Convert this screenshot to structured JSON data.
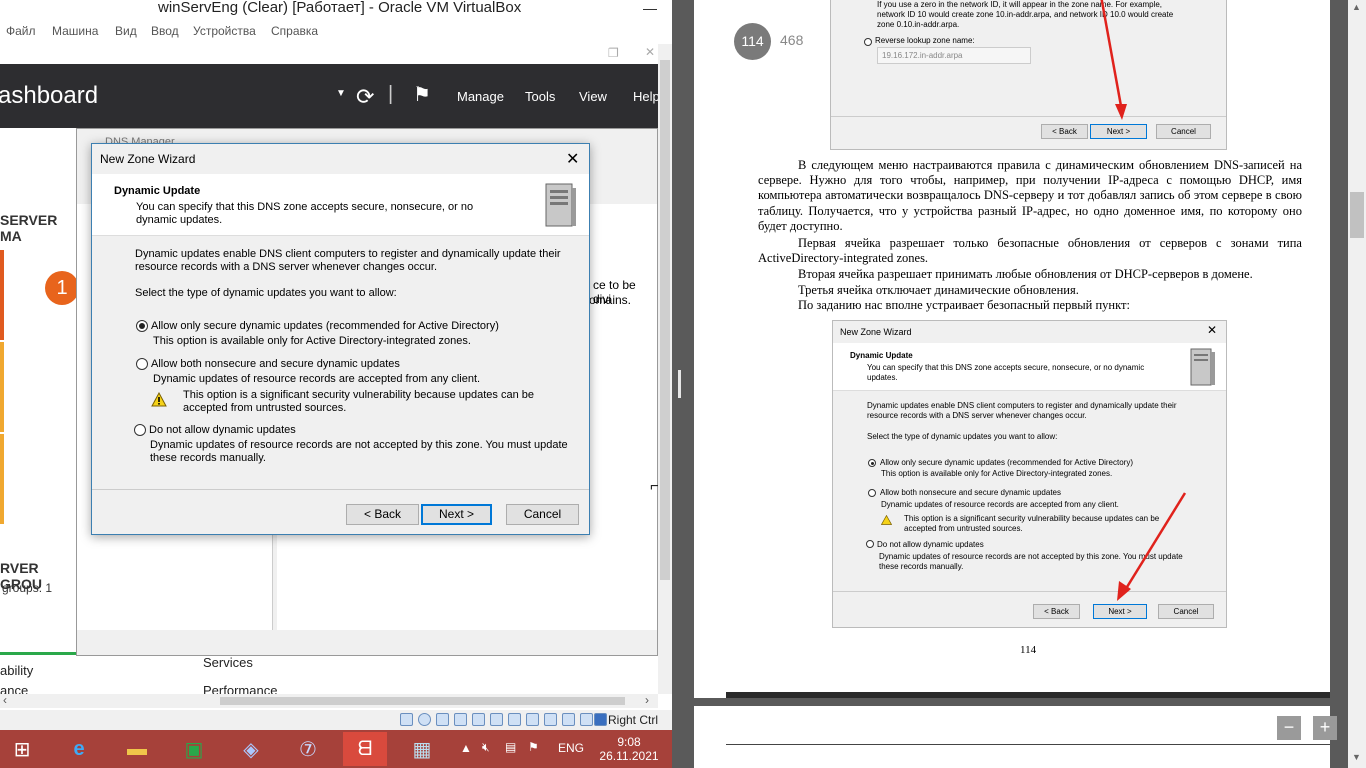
{
  "vbox": {
    "title": "winServEng (Clear) [Работает] - Oracle VM VirtualBox",
    "menu": [
      "Файл",
      "Машина",
      "Вид",
      "Ввод",
      "Устройства",
      "Справка"
    ],
    "status_right_ctrl": "Right Ctrl"
  },
  "server_manager": {
    "title": "ashboard",
    "menu": [
      "Manage",
      "Tools",
      "View",
      "Help"
    ],
    "left_heading": "SERVER MA",
    "groups_heading": "RVER GROU",
    "groups_count": "groups: 1",
    "quick_number": "1",
    "left_item": "ability",
    "lower_items": [
      "Services",
      "Performance"
    ],
    "lower_left": "ance",
    "partial_text": [
      "ce to be divi",
      "omains."
    ]
  },
  "dns_manager": {
    "title": "DNS Manager"
  },
  "wizard": {
    "title": "New Zone Wizard",
    "heading": "Dynamic Update",
    "subheading": "You can specify that this DNS zone accepts secure, nonsecure, or no dynamic updates.",
    "intro": "Dynamic updates enable DNS client computers to register and dynamically update their resource records with a DNS server whenever changes occur.",
    "prompt": "Select the type of dynamic updates you want to allow:",
    "options": [
      {
        "label": "Allow only secure dynamic updates (recommended for Active Directory)",
        "desc": "This option is available only for Active Directory-integrated zones.",
        "selected": true
      },
      {
        "label": "Allow both nonsecure and secure dynamic updates",
        "desc": "Dynamic updates of resource records are accepted from any client.",
        "warning": "This option is a significant security vulnerability because updates can be accepted from untrusted sources.",
        "selected": false
      },
      {
        "label": "Do not allow dynamic updates",
        "desc": "Dynamic updates of resource records are not accepted by this zone. You must update these records manually.",
        "selected": false
      }
    ],
    "back": "< Back",
    "next": "Next >",
    "cancel": "Cancel"
  },
  "taskbar": {
    "lang": "ENG",
    "time": "9:08",
    "date": "26.11.2021"
  },
  "pdf": {
    "current_page": "114",
    "total_pages": "468",
    "page_number": "114",
    "top_shot": {
      "text1": "If you use a zero in the network ID, it will appear in the zone name. For example, network ID 10 would create zone 10.in-addr.arpa, and network ID 10.0 would create zone 0.10.in-addr.arpa.",
      "radio": "Reverse lookup zone name:",
      "field": "19.16.172.in-addr.arpa",
      "back": "< Back",
      "next": "Next >",
      "cancel": "Cancel"
    },
    "paragraphs": [
      "В следующем меню настраиваются правила с динамическим обновлением DNS-записей на сервере. Нужно для того чтобы, например, при получении IP-адреса с помощью DHCP, имя компьютера автоматически возвращалось DNS-серверу и тот добавлял запись об этом сервере в свою таблицу. Получается, что у устройства разный IP-адрес, но одно доменное имя, по которому оно будет доступно.",
      "Первая ячейка разрешает только безопасные обновления от серверов с зонами типа ActiveDirectory-integrated zones.",
      "Вторая ячейка разрешает принимать любые обновления от DHCP-серверов в домене.",
      "Третья ячейка отключает динамические обновления.",
      "По заданию нас вполне устраивает безопасный первый пункт:"
    ],
    "zoom_minus": "−",
    "zoom_plus": "+"
  }
}
